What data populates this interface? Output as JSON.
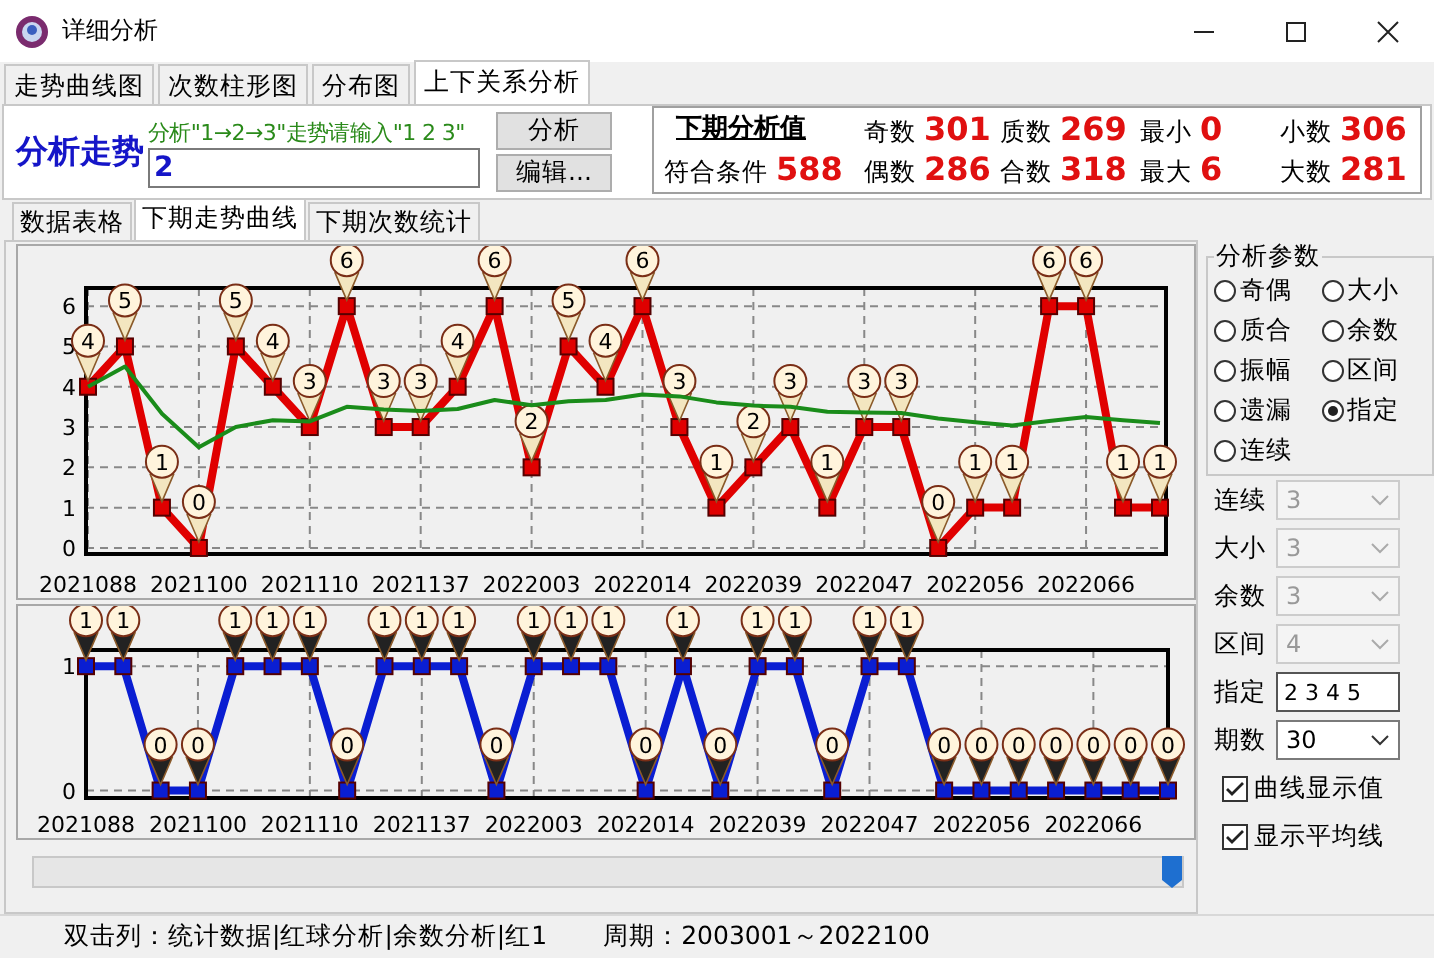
{
  "window": {
    "title": "详细分析"
  },
  "tabs": [
    {
      "label": "走势曲线图",
      "selected": false
    },
    {
      "label": "次数柱形图",
      "selected": false
    },
    {
      "label": "分布图",
      "selected": false
    },
    {
      "label": "上下关系分析",
      "selected": true
    }
  ],
  "analysis": {
    "heading": "分析走势",
    "hint": "分析\"1→2→3\"走势请输入\"1 2 3\"",
    "value": "2",
    "buttons": [
      "分析",
      "编辑..."
    ]
  },
  "next_values": {
    "title": "下期分析值",
    "match_label": "符合条件",
    "match_value": "588",
    "stats": [
      {
        "label": "奇数",
        "value": "301"
      },
      {
        "label": "质数",
        "value": "269"
      },
      {
        "label": "最小",
        "value": "0"
      },
      {
        "label": "小数",
        "value": "306"
      },
      {
        "label": "偶数",
        "value": "286"
      },
      {
        "label": "合数",
        "value": "318"
      },
      {
        "label": "最大",
        "value": "6"
      },
      {
        "label": "大数",
        "value": "281"
      }
    ]
  },
  "sub_tabs": [
    {
      "label": "数据表格",
      "selected": false
    },
    {
      "label": "下期走势曲线",
      "selected": true
    },
    {
      "label": "下期次数统计",
      "selected": false
    }
  ],
  "charts": [
    {
      "chart_data": {
        "type": "line",
        "grid": true,
        "categories": [
          "2021088",
          null,
          null,
          "2021100",
          null,
          null,
          "2021110",
          null,
          null,
          "2021137",
          null,
          null,
          "2022003",
          null,
          null,
          "2022014",
          null,
          null,
          "2022039",
          null,
          null,
          "2022047",
          null,
          null,
          "2022056",
          null,
          null,
          "2022066",
          null,
          null
        ],
        "series": [
          {
            "color": "#e00000",
            "marker": "square",
            "values": [
              4,
              5,
              1,
              0,
              5,
              4,
              3,
              6,
              3,
              3,
              4,
              6,
              2,
              5,
              4,
              6,
              3,
              1,
              2,
              3,
              1,
              3,
              3,
              0,
              1,
              1,
              6,
              6,
              1,
              1
            ],
            "value_labels": [
              "4",
              "5",
              "1",
              "0",
              "5",
              "4",
              "3",
              "6",
              "3",
              "3",
              "4",
              "6",
              "2",
              "5",
              "4",
              "6",
              "3",
              "1",
              "2",
              "3",
              "1",
              "3",
              "3",
              "0",
              "1",
              "1",
              "6",
              "6",
              "1",
              "1"
            ]
          },
          {
            "color": "#1a8c1a",
            "values": [
              4,
              4.5,
              3.33,
              2.5,
              3,
              3.17,
              3.14,
              3.5,
              3.44,
              3.4,
              3.45,
              3.67,
              3.54,
              3.64,
              3.67,
              3.81,
              3.76,
              3.61,
              3.53,
              3.5,
              3.38,
              3.36,
              3.35,
              3.21,
              3.12,
              3.04,
              3.15,
              3.25,
              3.17,
              3.1
            ]
          }
        ],
        "ylim": [
          -0.15,
          6.45
        ],
        "yticks": [
          0,
          1,
          2,
          3,
          4,
          5,
          6
        ]
      }
    },
    {
      "chart_data": {
        "type": "line",
        "grid": true,
        "categories": [
          "2021088",
          null,
          null,
          "2021100",
          null,
          null,
          "2021110",
          null,
          null,
          "2021137",
          null,
          null,
          "2022003",
          null,
          null,
          "2022014",
          null,
          null,
          "2022039",
          null,
          null,
          "2022047",
          null,
          null,
          "2022056",
          null,
          null,
          "2022066",
          null,
          null
        ],
        "series": [
          {
            "color": "#0a1ed2",
            "marker": "square",
            "values": [
              1,
              1,
              0,
              0,
              1,
              1,
              1,
              0,
              1,
              1,
              1,
              0,
              1,
              1,
              1,
              0,
              1,
              0,
              1,
              1,
              0,
              1,
              1,
              0,
              0,
              0,
              0,
              0,
              0,
              0
            ],
            "value_labels": [
              "1",
              "1",
              "0",
              "0",
              "1",
              "1",
              "1",
              "0",
              "1",
              "1",
              "1",
              "0",
              "1",
              "1",
              "1",
              "0",
              "1",
              "0",
              "1",
              "1",
              "0",
              "1",
              "1",
              "0",
              "0",
              "0",
              "0",
              "0",
              "0",
              "0"
            ]
          }
        ],
        "ylim": [
          -0.06,
          1.13
        ],
        "yticks": [
          0,
          1
        ]
      }
    }
  ],
  "range_slider": {
    "level": 1
  },
  "params": {
    "title": "分析参数",
    "options": [
      {
        "label": "奇偶",
        "selected": false
      },
      {
        "label": "大小",
        "selected": false
      },
      {
        "label": "质合",
        "selected": false
      },
      {
        "label": "余数",
        "selected": false
      },
      {
        "label": "振幅",
        "selected": false
      },
      {
        "label": "区间",
        "selected": false
      },
      {
        "label": "遗漏",
        "selected": false
      },
      {
        "label": "指定",
        "selected": true
      },
      {
        "label": "连续",
        "selected": false
      }
    ]
  },
  "settings": [
    {
      "kind": "select",
      "label": "连续",
      "value": "3",
      "disabled": true
    },
    {
      "kind": "select",
      "label": "大小",
      "value": "3",
      "disabled": true
    },
    {
      "kind": "select",
      "label": "余数",
      "value": "3",
      "disabled": true
    },
    {
      "kind": "select",
      "label": "区间",
      "value": "4",
      "disabled": true
    },
    {
      "kind": "input",
      "label": "指定",
      "value": "2 3 4 5",
      "disabled": false
    },
    {
      "kind": "select",
      "label": "期数",
      "value": "30",
      "disabled": false
    }
  ],
  "checkboxes": [
    {
      "label": "曲线显示值",
      "checked": true
    },
    {
      "label": "显示平均线",
      "checked": true
    }
  ],
  "status_bar": [
    {
      "text": "双击列：统计数据|红球分析|余数分析|红1"
    },
    {
      "text": "周期：2003001～2022100"
    }
  ]
}
